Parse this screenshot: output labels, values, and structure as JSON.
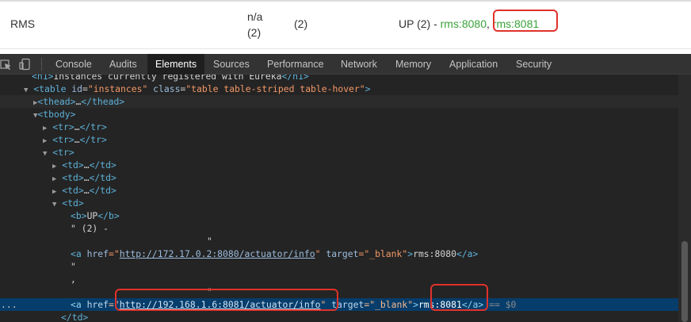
{
  "eureka_row": {
    "application": "RMS",
    "ami_line1": "n/a",
    "ami_line2": "(2)",
    "availability_zones": "(2)",
    "status_prefix": "UP (2) - ",
    "instance1": "rms:8080",
    "separator": ",",
    "instance2": "rms:8081"
  },
  "devtools": {
    "tabs": [
      "Console",
      "Audits",
      "Elements",
      "Sources",
      "Performance",
      "Network",
      "Memory",
      "Application",
      "Security"
    ],
    "active_tab": "Elements",
    "icons": [
      "inspect-element-icon",
      "device-toolbar-icon"
    ]
  },
  "dom": {
    "l0": {
      "open": "<h1>",
      "text": "Instances currently registered with Eureka",
      "close": "</h1>"
    },
    "l1": {
      "tag_open": "<table",
      "id_attr": "id",
      "id_val": "\"instances\"",
      "class_attr": "class",
      "class_val": "\"table table-striped table-hover\"",
      "tag_end": ">"
    },
    "l2": {
      "open": "<thead>",
      "ellipsis": "…",
      "close": "</thead>"
    },
    "l3": {
      "open": "<tbody>"
    },
    "l4": {
      "open": "<tr>",
      "ellipsis": "…",
      "close": "</tr>"
    },
    "l5": {
      "open": "<tr>",
      "ellipsis": "…",
      "close": "</tr>"
    },
    "l6": {
      "open": "<tr>"
    },
    "l7": {
      "open": "<td>",
      "ellipsis": "…",
      "close": "</td>"
    },
    "l8": {
      "open": "<td>",
      "ellipsis": "…",
      "close": "</td>"
    },
    "l9": {
      "open": "<td>",
      "ellipsis": "…",
      "close": "</td>"
    },
    "l10": {
      "open": "<td>"
    },
    "l11": {
      "open": "<b>",
      "text": "UP",
      "close": "</b>"
    },
    "l12": {
      "text": "\" (2) -"
    },
    "l13": {
      "text": "\""
    },
    "l14": {
      "tag_open": "<a",
      "href_attr": "href",
      "href_q1": "=\"",
      "href_url": "http://172.17.0.2:8080/actuator/info",
      "href_q2": "\"",
      "target_attr": "target",
      "target_val": "=\"_blank\"",
      "tag_end": ">",
      "text": "rms:8080",
      "close": "</a>"
    },
    "l15": {
      "text": "\""
    },
    "l16": {
      "text": ","
    },
    "l17": {
      "text": "\""
    },
    "l18": {
      "tag_open": "<a",
      "href_attr": "href",
      "href_q1": "=\"",
      "href_url": "http://192.168.1.6:8081/actuator/info",
      "href_q2": "\"",
      "target_attr": "target",
      "target_val": "=\"_blank\"",
      "tag_end": ">",
      "text": "rms:8081",
      "close": "</a>",
      "suffix": " == $0"
    },
    "l19": {
      "close": "</td>"
    },
    "gutter_marker": "..."
  }
}
